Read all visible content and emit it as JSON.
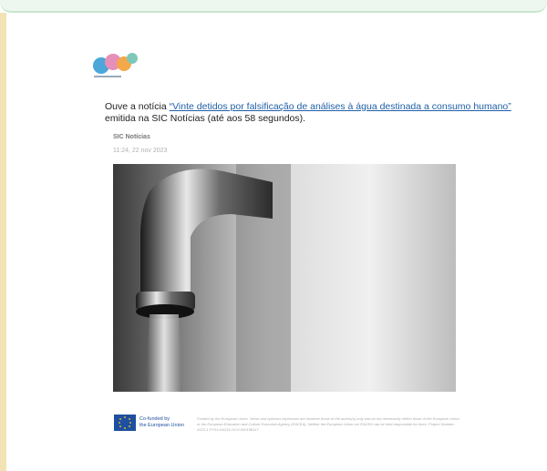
{
  "intro": {
    "prefix": "Ouve a notícia ",
    "link_text": "“Vinte detidos por falsificação de análises à água destinada a consumo humano”",
    "line2": "emitida na SIC Notícias (até aos 58 segundos)."
  },
  "article": {
    "source": "SIC Notícias",
    "timestamp": "11:24, 22 nov 2023"
  },
  "image": {
    "icon": "water-tap-photo"
  },
  "footer": {
    "cofunded_line1": "Co-funded by",
    "cofunded_line2": "the European Union",
    "disclaimer": "Funded by the European Union. Views and opinions expressed are however those of the author(s) only and do not necessarily reflect those of the European Union or the European Education and Culture Executive Agency (EACEA). Neither the European Union nor EACEA can be held responsible for them. Project Number: 2023-1-PT01-KA210-SCH-000158117"
  },
  "colors": {
    "link": "#1f5fa8",
    "eu_blue": "#1f4fa0",
    "eu_star": "#ffd617"
  }
}
